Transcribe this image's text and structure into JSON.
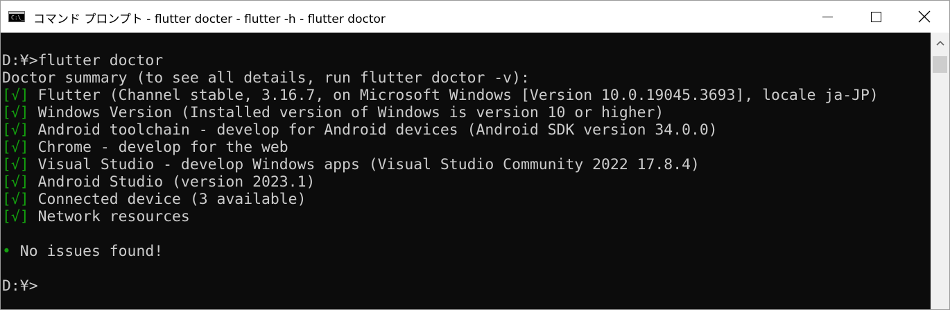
{
  "window": {
    "title": "コマンド プロンプト - flutter  docter - flutter  -h - flutter  doctor",
    "icon_glyph": "C:\\_"
  },
  "controls": {
    "minimize": "minimize-icon",
    "maximize": "maximize-icon",
    "close_glyph": "✕"
  },
  "console": {
    "prompt_cmd": "D:¥>flutter doctor",
    "summary": "Doctor summary (to see all details, run flutter doctor -v):",
    "check_mark": "[√]",
    "items": [
      " Flutter (Channel stable, 3.16.7, on Microsoft Windows [Version 10.0.19045.3693], locale ja-JP)",
      " Windows Version (Installed version of Windows is version 10 or higher)",
      " Android toolchain - develop for Android devices (Android SDK version 34.0.0)",
      " Chrome - develop for the web",
      " Visual Studio - develop Windows apps (Visual Studio Community 2022 17.8.4)",
      " Android Studio (version 2023.1)",
      " Connected device (3 available)",
      " Network resources"
    ],
    "bullet": "•",
    "result": " No issues found!",
    "prompt_end": "D:¥>"
  },
  "colors": {
    "console_bg": "#0c0c0c",
    "console_text": "#cccccc",
    "check_green": "#13a10e"
  }
}
